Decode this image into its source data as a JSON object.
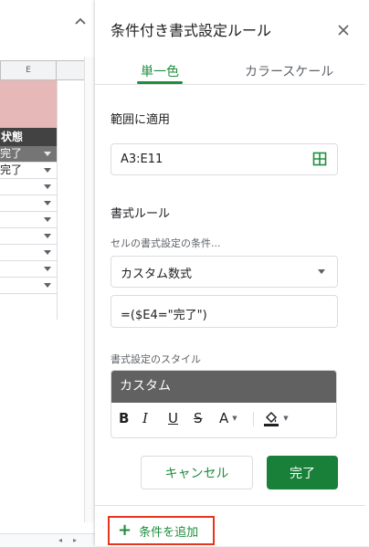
{
  "sheet": {
    "column_header": "E",
    "header_cell": "状態",
    "rows": [
      {
        "text": "完了",
        "dark": true
      },
      {
        "text": "完了",
        "dark": false
      },
      {
        "text": "",
        "dark": false
      },
      {
        "text": "",
        "dark": false
      },
      {
        "text": "",
        "dark": false
      },
      {
        "text": "",
        "dark": false
      },
      {
        "text": "",
        "dark": false
      },
      {
        "text": "",
        "dark": false
      },
      {
        "text": "",
        "dark": false
      }
    ]
  },
  "panel": {
    "title": "条件付き書式設定ルール",
    "tabs": [
      {
        "label": "単一色",
        "active": true
      },
      {
        "label": "カラースケール",
        "active": false
      }
    ],
    "apply_range_label": "範囲に適用",
    "apply_range_value": "A3:E11",
    "format_rules_label": "書式ルール",
    "condition_label": "セルの書式設定の条件...",
    "condition_selected": "カスタム数式",
    "formula_value": "=($E4=\"完了\")",
    "style_label": "書式設定のスタイル",
    "style_preview": "カスタム",
    "toolbar": {
      "bold": "B",
      "italic": "I",
      "underline": "U",
      "strikethrough": "S",
      "text_color": "A"
    },
    "cancel_label": "キャンセル",
    "done_label": "完了",
    "add_rule_label": "条件を追加"
  },
  "colors": {
    "accent_green": "#1e8e3e",
    "done_button": "#188038",
    "highlight_border": "#e8341c",
    "pink_cells": "#e6b8b7",
    "style_preview_bg": "#616161"
  }
}
